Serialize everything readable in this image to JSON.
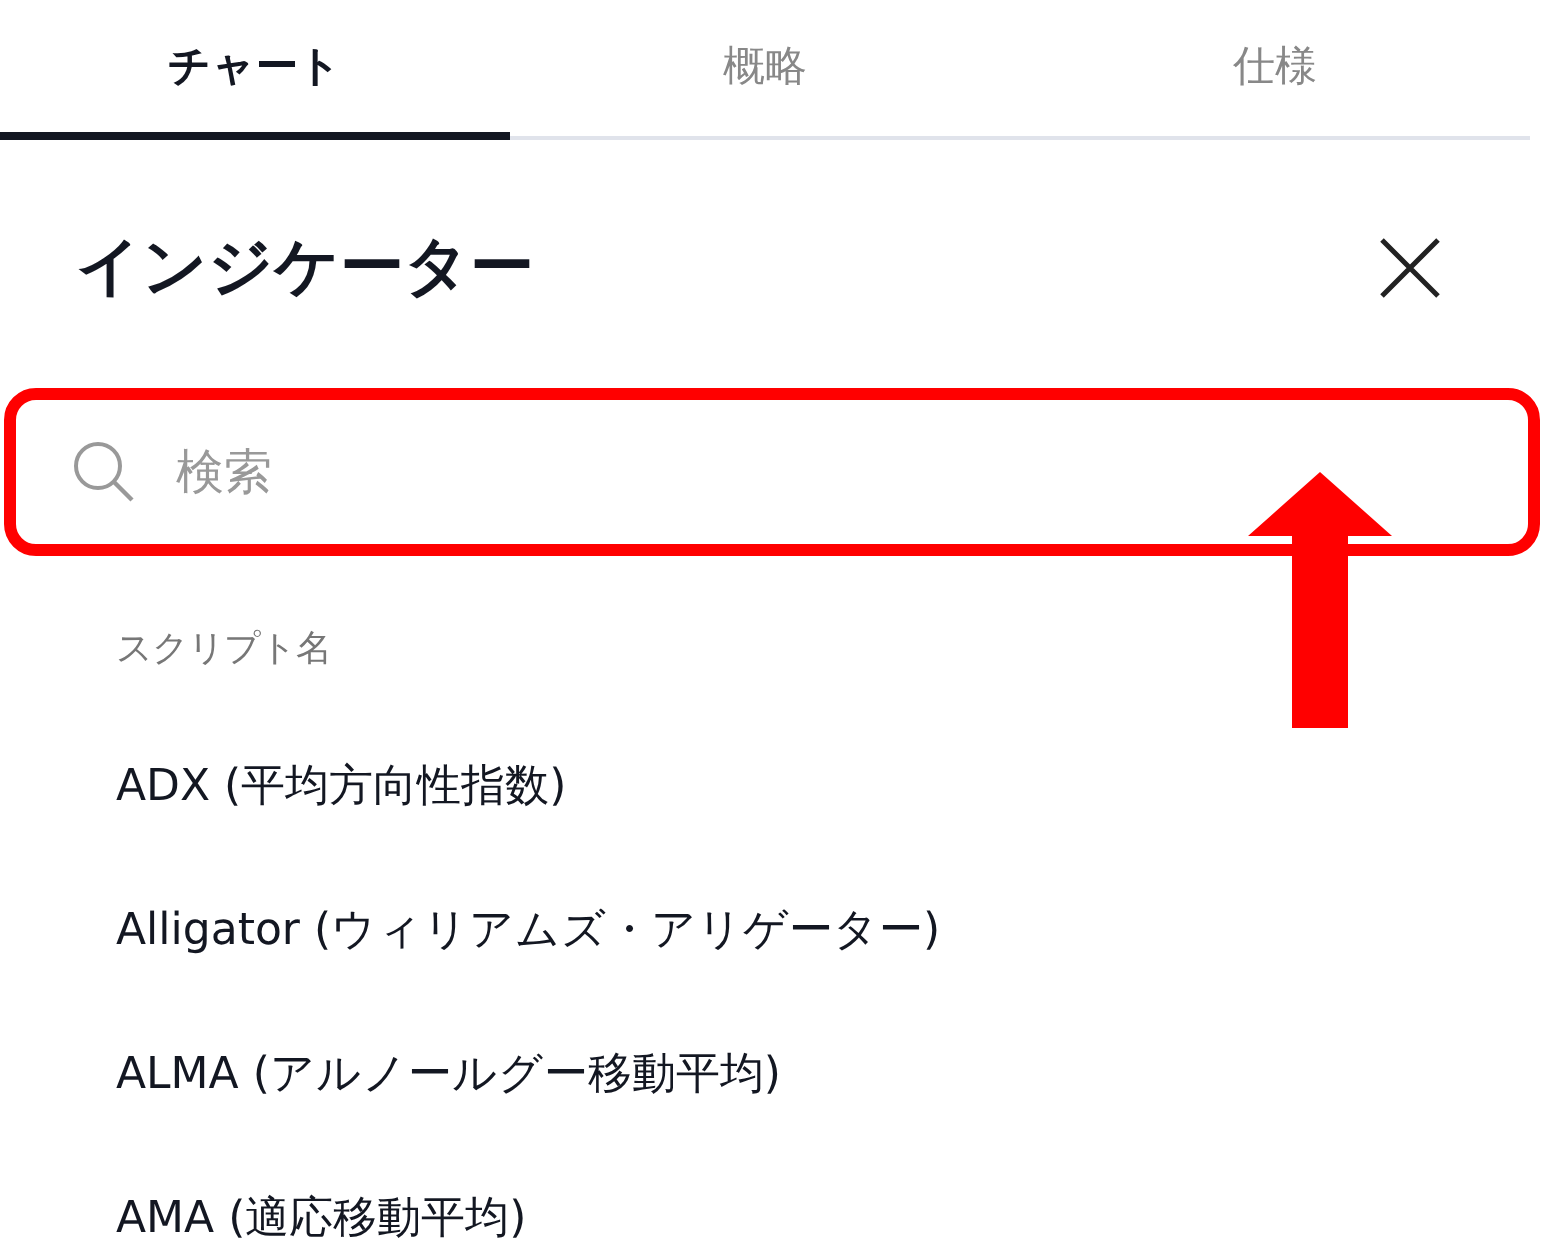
{
  "tabs": [
    {
      "label": "チャート",
      "selected": true
    },
    {
      "label": "概略",
      "selected": false
    },
    {
      "label": "仕様",
      "selected": false
    }
  ],
  "panel": {
    "title": "インジケーター"
  },
  "search": {
    "placeholder": "検索"
  },
  "section": {
    "heading": "スクリプト名"
  },
  "scripts": [
    "ADX (平均方向性指数)",
    "Alligator (ウィリアムズ・アリゲーター)",
    "ALMA (アルノールグー移動平均)",
    "AMA (適応移動平均)"
  ]
}
